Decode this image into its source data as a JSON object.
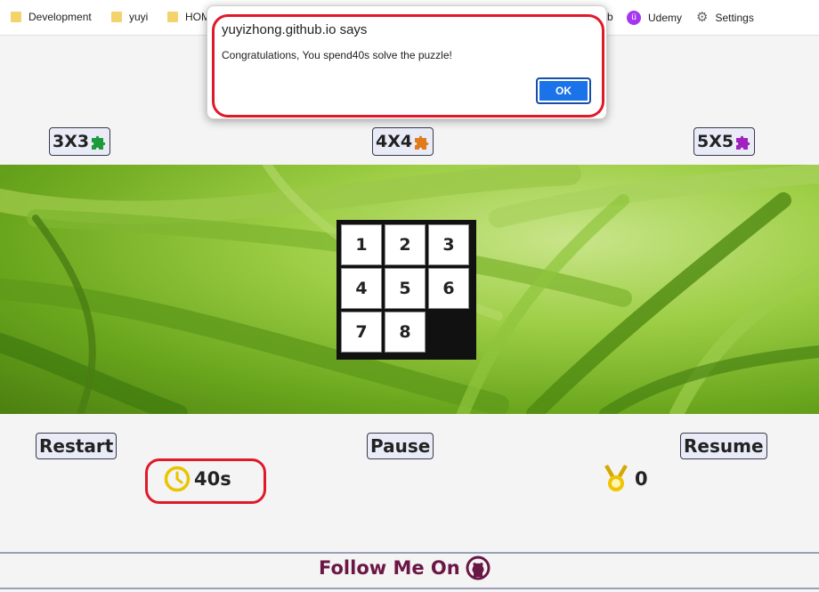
{
  "bookmarks": {
    "items": [
      {
        "label": "Development",
        "icon": "folder-icon"
      },
      {
        "label": "yuyi",
        "icon": "folder-icon"
      },
      {
        "label": "HOM",
        "icon": "folder-icon"
      },
      {
        "label": "b",
        "icon": ""
      },
      {
        "label": "Udemy",
        "icon": "udemy-icon"
      },
      {
        "label": "Settings",
        "icon": "gear-icon"
      }
    ]
  },
  "dialog": {
    "title": "yuyizhong.github.io says",
    "message": "Congratulations, You spend40s solve the puzzle!",
    "ok_label": "OK"
  },
  "sizes": {
    "items": [
      {
        "label": "3X3",
        "icon": "puzzle-icon",
        "color": "#1f9a3a"
      },
      {
        "label": "4X4",
        "icon": "puzzle-icon",
        "color": "#e07a1a"
      },
      {
        "label": "5X5",
        "icon": "puzzle-icon",
        "color": "#a020c0"
      }
    ]
  },
  "board": {
    "tiles": [
      "1",
      "2",
      "3",
      "4",
      "5",
      "6",
      "7",
      "8",
      ""
    ]
  },
  "controls": {
    "restart_label": "Restart",
    "pause_label": "Pause",
    "resume_label": "Resume"
  },
  "timer": {
    "value": "40s",
    "icon": "clock-icon"
  },
  "score": {
    "value": "0",
    "icon": "medal-icon"
  },
  "footer": {
    "text": "Follow Me On",
    "icon": "github-icon"
  },
  "colors": {
    "accent_red": "#e0192a",
    "ok_blue": "#1a73e8",
    "footer_text": "#6b1745"
  }
}
